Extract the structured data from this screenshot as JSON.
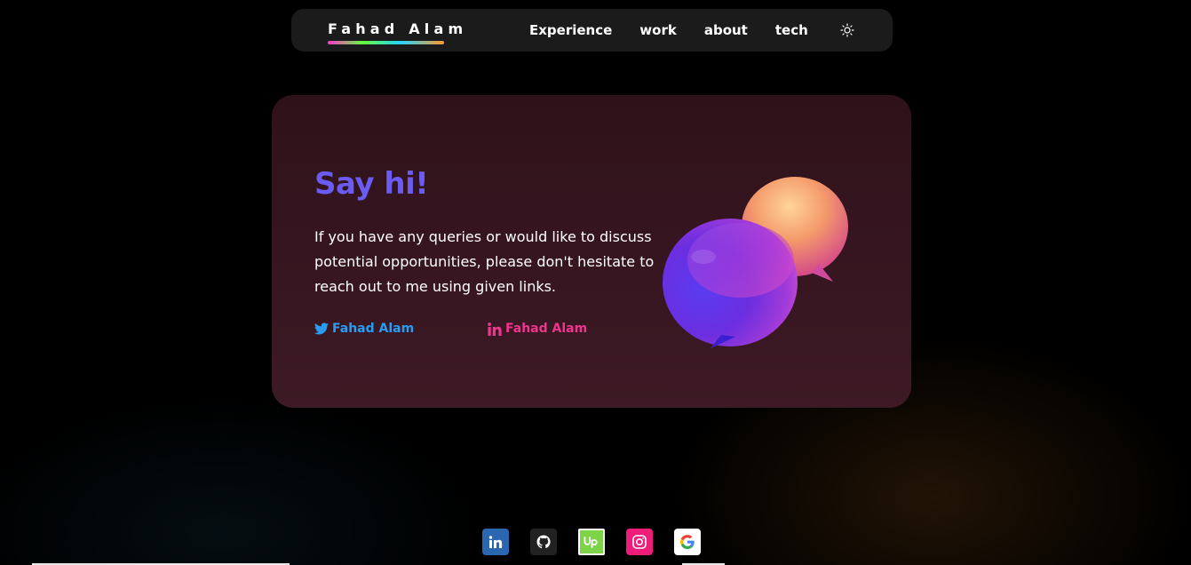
{
  "navbar": {
    "brand": "Fahad Alam",
    "links": [
      {
        "label": "Experience"
      },
      {
        "label": "work"
      },
      {
        "label": "about"
      },
      {
        "label": "tech"
      }
    ],
    "theme_icon": "sun-icon"
  },
  "contact": {
    "title": "Say hi!",
    "text": "If you have any queries or would like to discuss potential opportunities, please don't hesitate to reach out to me using given links.",
    "links": [
      {
        "platform": "twitter",
        "icon": "twitter-icon",
        "label": "Fahad Alam",
        "color": "#2a9cf2"
      },
      {
        "platform": "linkedin",
        "icon": "linkedin-icon",
        "label": "Fahad Alam",
        "color": "#f0358f"
      }
    ],
    "illustration": "chat-bubbles-illustration"
  },
  "footer": {
    "socials": [
      {
        "icon": "linkedin-icon",
        "color": "#2b67b0"
      },
      {
        "icon": "github-icon",
        "color": "#222222"
      },
      {
        "icon": "upwork-icon",
        "color": "#7ed348"
      },
      {
        "icon": "instagram-icon",
        "color": "#ef1d7a"
      },
      {
        "icon": "google-icon",
        "color": "#ffffff"
      }
    ]
  },
  "colors": {
    "title_accent": "#6a5cf0",
    "card_bg": "#361520",
    "navbar_bg": "#1b1b1b"
  }
}
